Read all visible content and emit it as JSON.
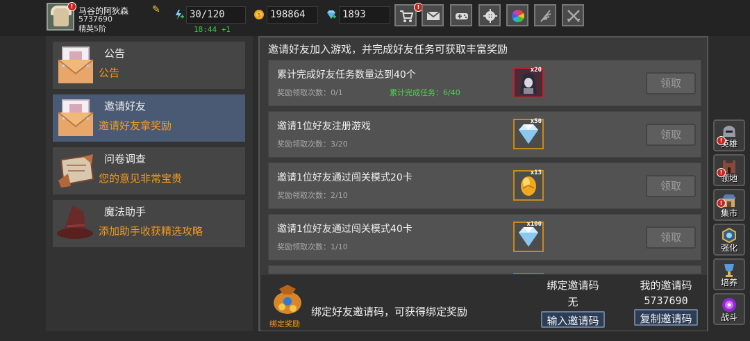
{
  "player": {
    "name": "马谷的阿狄森",
    "id": "5737690",
    "rank": "精英5阶",
    "notify": "!"
  },
  "resources": {
    "energy": "30/120",
    "energy_timer": "18:44 +1",
    "gold": "198864",
    "gems": "1893"
  },
  "toolbar": {
    "icons": [
      "shop-cart-icon",
      "mail-icon",
      "gamepad-icon",
      "gear-icon",
      "color-wheel-icon",
      "feather-icon",
      "crossed-swords-icon"
    ],
    "shop_badge": "!"
  },
  "menu": [
    {
      "title": "公告",
      "subtitle": "公告"
    },
    {
      "title": "邀请好友",
      "subtitle": "邀请好友拿奖励"
    },
    {
      "title": "问卷调查",
      "subtitle": "您的意见非常宝贵"
    },
    {
      "title": "魔法助手",
      "subtitle": "添加助手收获精选攻略"
    }
  ],
  "invite": {
    "header": "邀请好友加入游戏，并完成好友任务可获取丰富奖励",
    "tasks": [
      {
        "name": "累计完成好友任务数量达到40个",
        "count": "奖励领取次数：0/1",
        "progress": "累计完成任务：6/40",
        "reward_qty": "x20",
        "reward_icon": "hooded-hero-icon",
        "claim": "领取"
      },
      {
        "name": "邀请1位好友注册游戏",
        "count": "奖励领取次数：3/20",
        "progress": "",
        "reward_qty": "x50",
        "reward_icon": "diamond-icon",
        "claim": "领取"
      },
      {
        "name": "邀请1位好友通过闯关模式20卡",
        "count": "奖励领取次数：2/10",
        "progress": "",
        "reward_qty": "x13",
        "reward_icon": "golden-egg-icon",
        "claim": "领取"
      },
      {
        "name": "邀请1位好友通过闯关模式40卡",
        "count": "奖励领取次数：1/10",
        "progress": "",
        "reward_qty": "x100",
        "reward_icon": "diamond-icon",
        "claim": "领取"
      }
    ],
    "bind": {
      "bag_label": "绑定奖励",
      "text": "绑定好友邀请码，可获得绑定奖励",
      "bound_title": "绑定邀请码",
      "bound_value": "无",
      "bound_button": "输入邀请码",
      "mine_title": "我的邀请码",
      "mine_value": "5737690",
      "mine_button": "复制邀请码"
    }
  },
  "sidenav": [
    {
      "label": "英雄",
      "alert": true
    },
    {
      "label": "领地",
      "alert": true
    },
    {
      "label": "集市",
      "alert": true
    },
    {
      "label": "强化",
      "alert": false
    },
    {
      "label": "培养",
      "alert": false
    },
    {
      "label": "战斗",
      "alert": false
    }
  ],
  "colors": {
    "accent_orange": "#f29a1e",
    "progress_green": "#4fd34f",
    "selected_bg": "#4a5a74",
    "alert_red": "#c8241c"
  }
}
